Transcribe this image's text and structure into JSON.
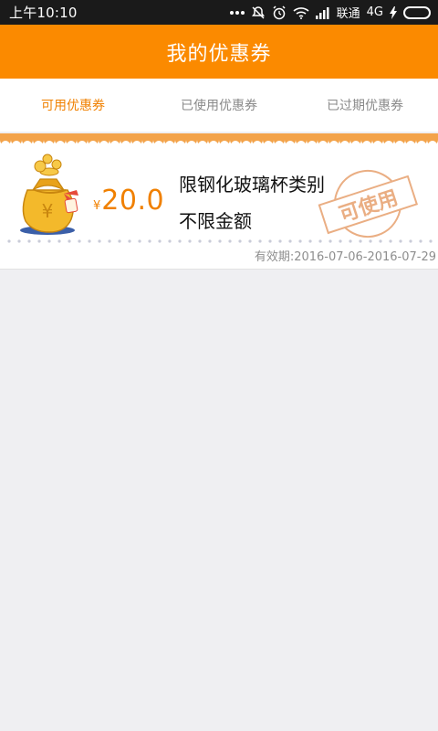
{
  "status_bar": {
    "time": "上午10:10",
    "dots": "...",
    "carrier": "联通",
    "network": "4G"
  },
  "header": {
    "title": "我的优惠券"
  },
  "tabs": [
    {
      "label": "可用优惠券",
      "active": true
    },
    {
      "label": "已使用优惠券",
      "active": false
    },
    {
      "label": "已过期优惠券",
      "active": false
    }
  ],
  "coupons": [
    {
      "currency": "¥",
      "amount": "20.0",
      "category": "限钢化玻璃杯类别",
      "limit": "不限金额",
      "stamp": "可使用",
      "validity": "有效期:2016-07-06-2016-07-29"
    }
  ],
  "colors": {
    "accent": "#fb8a00",
    "active_tab": "#f08000",
    "background": "#efeff2"
  }
}
